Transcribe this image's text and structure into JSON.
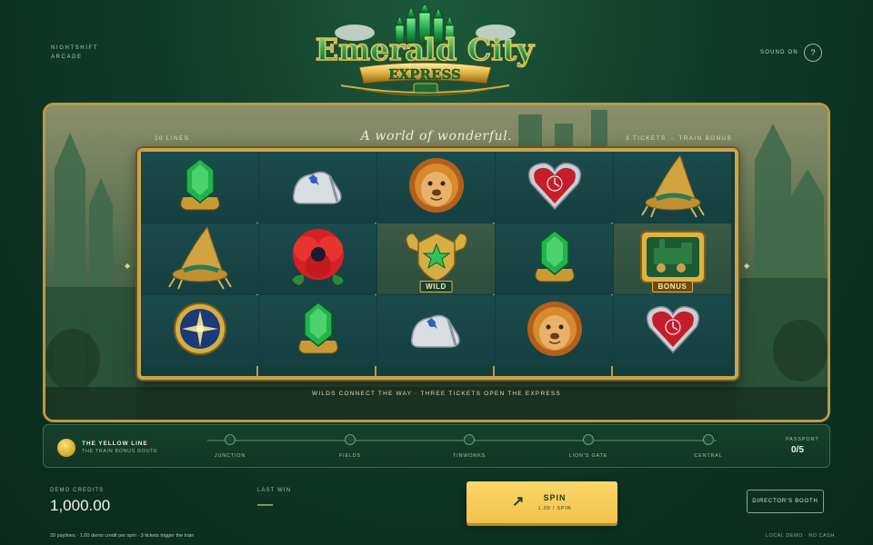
{
  "header": {
    "brand_line1": "NIGHTSHIFT",
    "brand_line2": "ARCADE",
    "logo_line1": "Emerald City",
    "logo_line2": "EXPRESS",
    "sound_label": "SOUND ON",
    "help_label": "?"
  },
  "stage": {
    "lines_label": "20 LINES",
    "tagline": "A world of wonderful.",
    "bonus_info": "3 TICKETS → TRAIN BONUS",
    "footline": "WILDS CONNECT THE WAY · THREE TICKETS OPEN THE EXPRESS",
    "side_marker": "◆"
  },
  "reels": {
    "grid": [
      [
        "emerald",
        "slipper",
        "lion",
        "heart",
        "scarecrow"
      ],
      [
        "scarecrow",
        "poppy",
        "wild",
        "emerald",
        "bonus"
      ],
      [
        "compass",
        "emerald",
        "slipper",
        "lion",
        "heart"
      ]
    ],
    "wild_label": "WILD",
    "bonus_label": "BONUS"
  },
  "route": {
    "title": "THE YELLOW LINE",
    "subtitle": "THE TRAIN BONUS ROUTE",
    "stops": [
      "JUNCTION",
      "FIELDS",
      "TINWORKS",
      "LION'S GATE",
      "CENTRAL"
    ],
    "passport_label": "PASSPORT",
    "passport_value": "0/5"
  },
  "footer": {
    "credits_label": "DEMO CREDITS",
    "credits_value": "1,000.00",
    "lastwin_label": "LAST WIN",
    "lastwin_value": "—",
    "spin_icon": "↗",
    "spin_label": "SPIN",
    "spin_sub": "1.00 / SPIN",
    "booth_label": "DIRECTOR'S BOOTH",
    "footnote": "20 paylines · 1.00 demo credit per spin · 3 tickets trigger the train",
    "localdemo": "LOCAL DEMO · NO CASH"
  },
  "colors": {
    "gold": "#c8a54e",
    "emerald": "#1f9a4a",
    "spin_button": "#f1c24c"
  }
}
